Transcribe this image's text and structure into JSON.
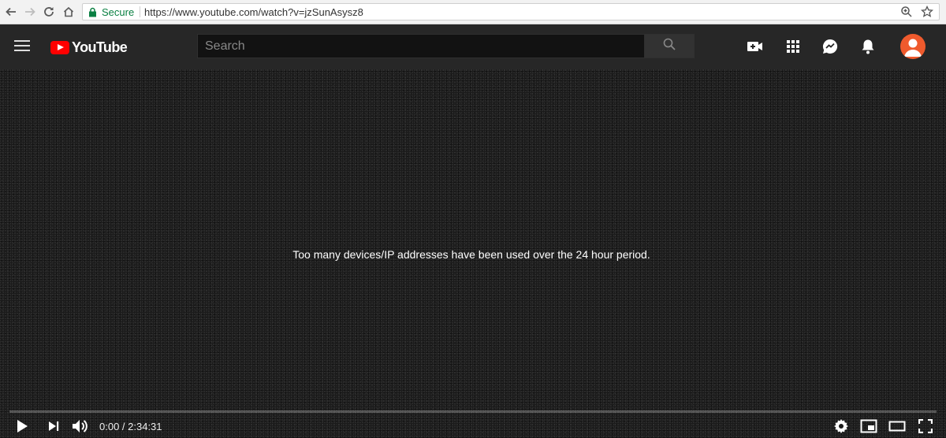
{
  "browser": {
    "secure_label": "Secure",
    "url": "https://www.youtube.com/watch?v=jzSunAsysz8"
  },
  "masthead": {
    "logo_text": "YouTube",
    "search_placeholder": "Search"
  },
  "player": {
    "error_message": "Too many devices/IP addresses have been used over the 24 hour period.",
    "time_display": "0:00 / 2:34:31",
    "progress_fraction": 0
  },
  "colors": {
    "brand_red": "#ff0000",
    "masthead_bg": "#272727",
    "secure_green": "#0b8043",
    "avatar_bg": "#ef5a2d"
  },
  "icons": {
    "browser": [
      "back-icon",
      "forward-icon",
      "reload-icon",
      "home-icon",
      "lock-icon",
      "zoom-icon",
      "star-icon"
    ],
    "masthead": [
      "menu-icon",
      "youtube-logo-icon",
      "search-icon",
      "create-video-icon",
      "apps-icon",
      "messages-icon",
      "notifications-icon",
      "avatar-icon"
    ],
    "player": [
      "play-icon",
      "next-icon",
      "volume-icon",
      "settings-icon",
      "miniplayer-icon",
      "theater-icon",
      "fullscreen-icon"
    ]
  }
}
